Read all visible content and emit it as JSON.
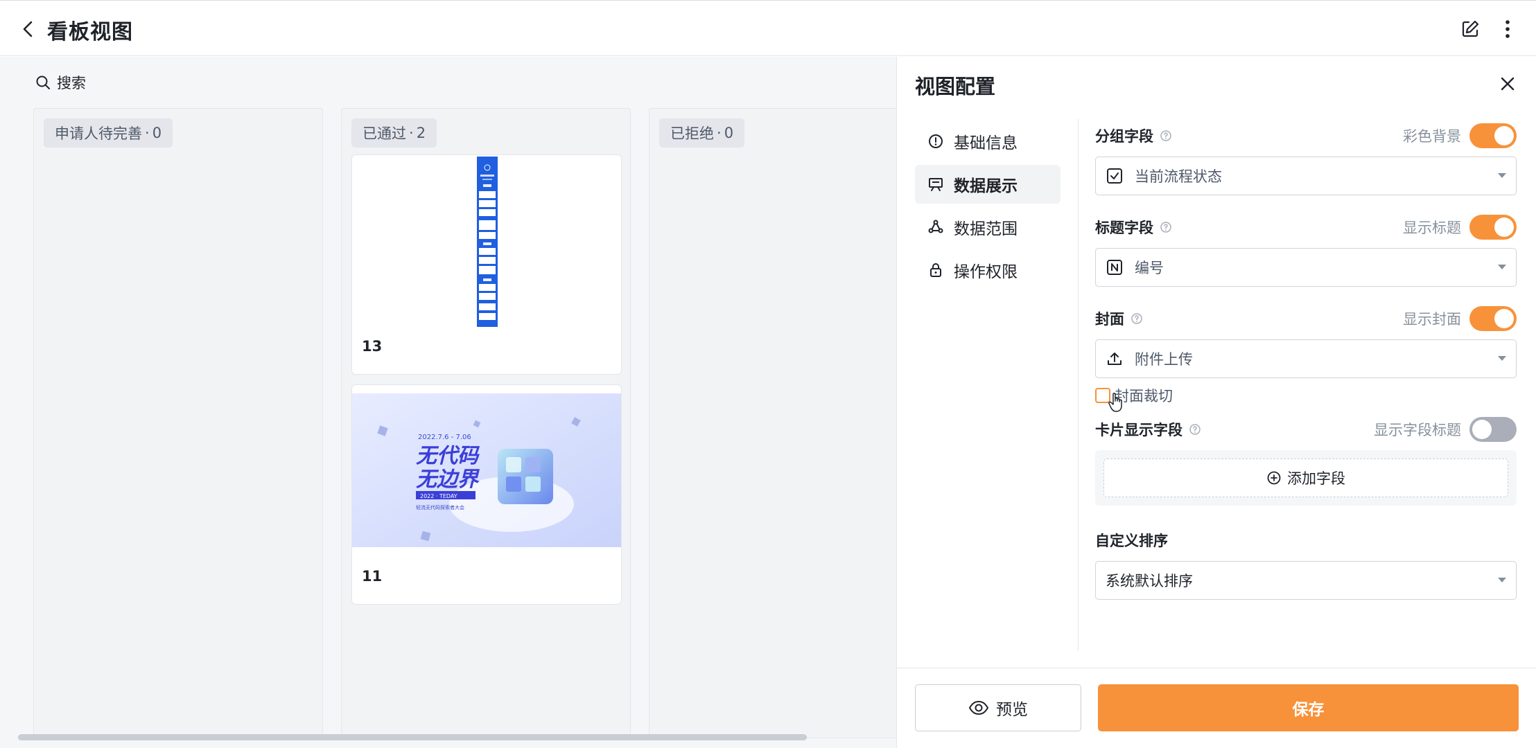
{
  "header": {
    "title": "看板视图",
    "icons": {
      "back": "chevron-left-icon",
      "edit": "edit-icon",
      "more": "more-vertical-icon"
    }
  },
  "board": {
    "search_label": "搜索",
    "columns": [
      {
        "name": "申请人待完善",
        "count": "0"
      },
      {
        "name": "已通过",
        "count": "2",
        "cards": [
          {
            "title": "13"
          },
          {
            "title": "11"
          }
        ]
      },
      {
        "name": "已拒绝",
        "count": "0"
      }
    ],
    "cover_texts": {
      "date": "2022.7.6 - 7.06",
      "line1": "无代码",
      "line2": "无边界",
      "banner": "2022 · TEDAY",
      "caption": "轻流无代码探索者大会"
    }
  },
  "panel": {
    "title": "视图配置",
    "nav": [
      {
        "label": "基础信息",
        "icon": "info-circle-icon"
      },
      {
        "label": "数据展示",
        "icon": "presentation-icon",
        "active": true
      },
      {
        "label": "数据范围",
        "icon": "scope-icon"
      },
      {
        "label": "操作权限",
        "icon": "lock-icon"
      }
    ],
    "group_field": {
      "label": "分组字段",
      "toggle_label": "彩色背景",
      "toggle_on": true,
      "value": "当前流程状态"
    },
    "title_field": {
      "label": "标题字段",
      "toggle_label": "显示标题",
      "toggle_on": true,
      "value": "编号"
    },
    "cover": {
      "label": "封面",
      "toggle_label": "显示封面",
      "toggle_on": true,
      "value": "附件上传",
      "crop_label": "封面裁切",
      "crop_checked": false
    },
    "card_fields": {
      "label": "卡片显示字段",
      "toggle_label": "显示字段标题",
      "toggle_on": false,
      "add_label": "添加字段"
    },
    "sort": {
      "label": "自定义排序",
      "value": "系统默认排序"
    },
    "preview_label": "预览",
    "save_label": "保存"
  },
  "colors": {
    "accent": "#f7923a",
    "board_bg": "#f5f6f8"
  }
}
